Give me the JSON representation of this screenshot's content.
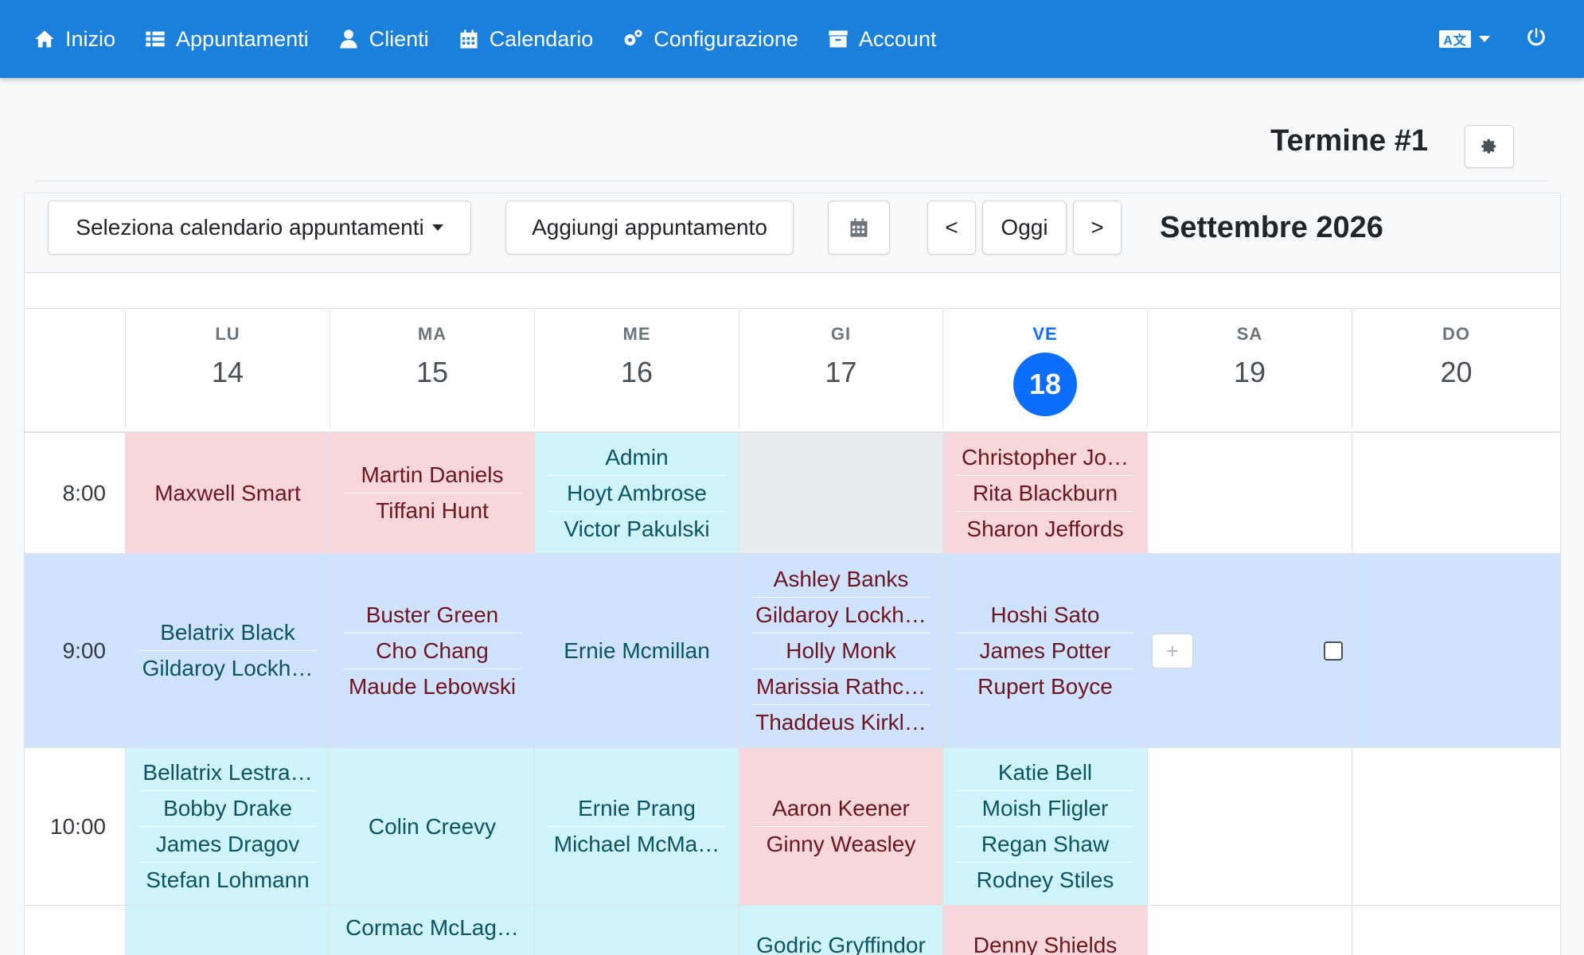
{
  "nav": {
    "items": [
      {
        "label": "Inizio",
        "icon": "home-icon"
      },
      {
        "label": "Appuntamenti",
        "icon": "list-icon"
      },
      {
        "label": "Clienti",
        "icon": "user-icon"
      },
      {
        "label": "Calendario",
        "icon": "calendar-icon"
      },
      {
        "label": "Configurazione",
        "icon": "cogs-icon"
      },
      {
        "label": "Account",
        "icon": "archive-icon"
      }
    ],
    "language_icon": "language-icon",
    "power_icon": "power-icon"
  },
  "header": {
    "title": "Termine #1",
    "settings_icon": "gear-icon"
  },
  "toolbar": {
    "select_calendar": "Seleziona calendario appuntamenti",
    "add_appointment": "Aggiungi appuntamento",
    "prev": "<",
    "today": "Oggi",
    "next": ">",
    "month": "Settembre 2026"
  },
  "days": [
    {
      "dow": "LU",
      "num": "14"
    },
    {
      "dow": "MA",
      "num": "15"
    },
    {
      "dow": "ME",
      "num": "16"
    },
    {
      "dow": "GI",
      "num": "17"
    },
    {
      "dow": "VE",
      "num": "18"
    },
    {
      "dow": "SA",
      "num": "19"
    },
    {
      "dow": "DO",
      "num": "20"
    }
  ],
  "today_index": 4,
  "rows": [
    {
      "time": "8:00",
      "cells": [
        {
          "style": "pink",
          "names": [
            "Maxwell Smart"
          ]
        },
        {
          "style": "pink",
          "names": [
            "Martin Daniels",
            "Tiffani Hunt"
          ]
        },
        {
          "style": "cyan",
          "names": [
            "Admin",
            "Hoyt Ambrose",
            "Victor Pakulski"
          ]
        },
        {
          "style": "grey",
          "names": []
        },
        {
          "style": "pink",
          "names": [
            "Christopher Jo…",
            "Rita Blackburn",
            "Sharon Jeffords"
          ]
        },
        {
          "style": "white",
          "names": []
        },
        {
          "style": "white",
          "names": []
        }
      ]
    },
    {
      "time": "9:00",
      "cells": [
        {
          "style": "blue",
          "names": [
            "Belatrix Black",
            "Gildaroy Lockh…"
          ]
        },
        {
          "style": "blue redtext",
          "names": [
            "Buster Green",
            "Cho Chang",
            "Maude Lebowski"
          ]
        },
        {
          "style": "blue",
          "names": [
            "Ernie Mcmillan"
          ]
        },
        {
          "style": "blue redtext",
          "names": [
            "Ashley Banks",
            "Gildaroy Lockh…",
            "Holly Monk",
            "Marissia Rathc…",
            "Thaddeus Kirkl…"
          ]
        },
        {
          "style": "blue redtext",
          "names": [
            "Hoshi Sato",
            "James Potter",
            "Rupert Boyce"
          ]
        },
        {
          "style": "blue",
          "names": []
        },
        {
          "style": "blue",
          "names": []
        }
      ]
    },
    {
      "time": "10:00",
      "cells": [
        {
          "style": "cyan",
          "names": [
            "Bellatrix Lestra…",
            "Bobby Drake",
            "James Dragov",
            "Stefan Lohmann"
          ]
        },
        {
          "style": "cyan",
          "names": [
            "Colin Creevy"
          ]
        },
        {
          "style": "cyan",
          "names": [
            "Ernie Prang",
            "Michael McMa…"
          ]
        },
        {
          "style": "pink",
          "names": [
            "Aaron Keener",
            "Ginny Weasley"
          ]
        },
        {
          "style": "cyan",
          "names": [
            "Katie Bell",
            "Moish Fligler",
            "Regan Shaw",
            "Rodney Stiles"
          ]
        },
        {
          "style": "white",
          "names": []
        },
        {
          "style": "white",
          "names": []
        }
      ]
    },
    {
      "time": "",
      "cells": [
        {
          "style": "cyan",
          "names": []
        },
        {
          "style": "cyan",
          "names": [
            "Cormac McLag…"
          ]
        },
        {
          "style": "cyan",
          "names": []
        },
        {
          "style": "cyan",
          "names": [
            "Godric Gryffindor"
          ]
        },
        {
          "style": "pink",
          "names": [
            "Denny Shields"
          ]
        },
        {
          "style": "white",
          "names": []
        },
        {
          "style": "white",
          "names": []
        }
      ]
    }
  ],
  "plus_label": "+",
  "colors": {
    "navbar": "#1a80dc",
    "today": "#0d6efd",
    "pink": "#f8d7da",
    "cyan": "#cff4fc",
    "blue": "#cfe2ff",
    "grey": "#e9ecef"
  }
}
